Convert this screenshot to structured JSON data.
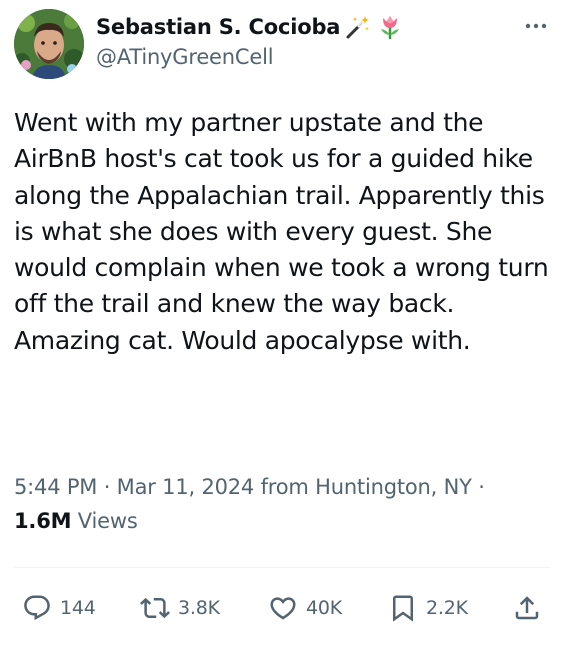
{
  "author": {
    "display_name": "Sebastian S. Cocioba",
    "handle": "@ATinyGreenCell",
    "name_emojis": [
      "magic-wand-emoji",
      "tulip-emoji"
    ]
  },
  "tweet": {
    "text": "Went with my partner upstate and the AirBnB host's cat took us for a guided hike along the Appalachian trail. Apparently this is what she does with every guest. She would complain when we took a wrong turn off the trail and knew the way back. Amazing cat. Would apocalypse with."
  },
  "meta": {
    "time": "5:44 PM",
    "separator": "·",
    "date": "Mar 11, 2024",
    "location": "from Huntington, NY",
    "views_count": "1.6M",
    "views_label": "Views"
  },
  "actions": {
    "replies": "144",
    "reposts": "3.8K",
    "likes": "40K",
    "bookmarks": "2.2K"
  },
  "colors": {
    "text": "#0f1419",
    "secondary": "#536471",
    "divider": "#eff3f4"
  }
}
